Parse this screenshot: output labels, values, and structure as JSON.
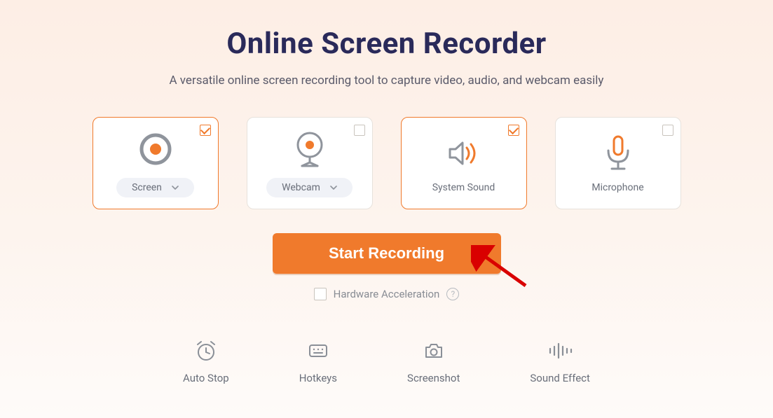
{
  "header": {
    "title": "Online Screen Recorder",
    "subtitle": "A versatile online screen recording tool to capture video, audio, and webcam easily"
  },
  "cards": {
    "screen": {
      "label": "Screen",
      "selected": true
    },
    "webcam": {
      "label": "Webcam",
      "selected": false
    },
    "system_sound": {
      "label": "System Sound",
      "selected": true
    },
    "microphone": {
      "label": "Microphone",
      "selected": false
    }
  },
  "actions": {
    "start_label": "Start Recording",
    "hwaccel_label": "Hardware Acceleration",
    "help_glyph": "?"
  },
  "tools": {
    "auto_stop": "Auto Stop",
    "hotkeys": "Hotkeys",
    "screenshot": "Screenshot",
    "sound_effect": "Sound Effect"
  },
  "colors": {
    "accent": "#f07a2c",
    "title": "#2a2a5a"
  }
}
